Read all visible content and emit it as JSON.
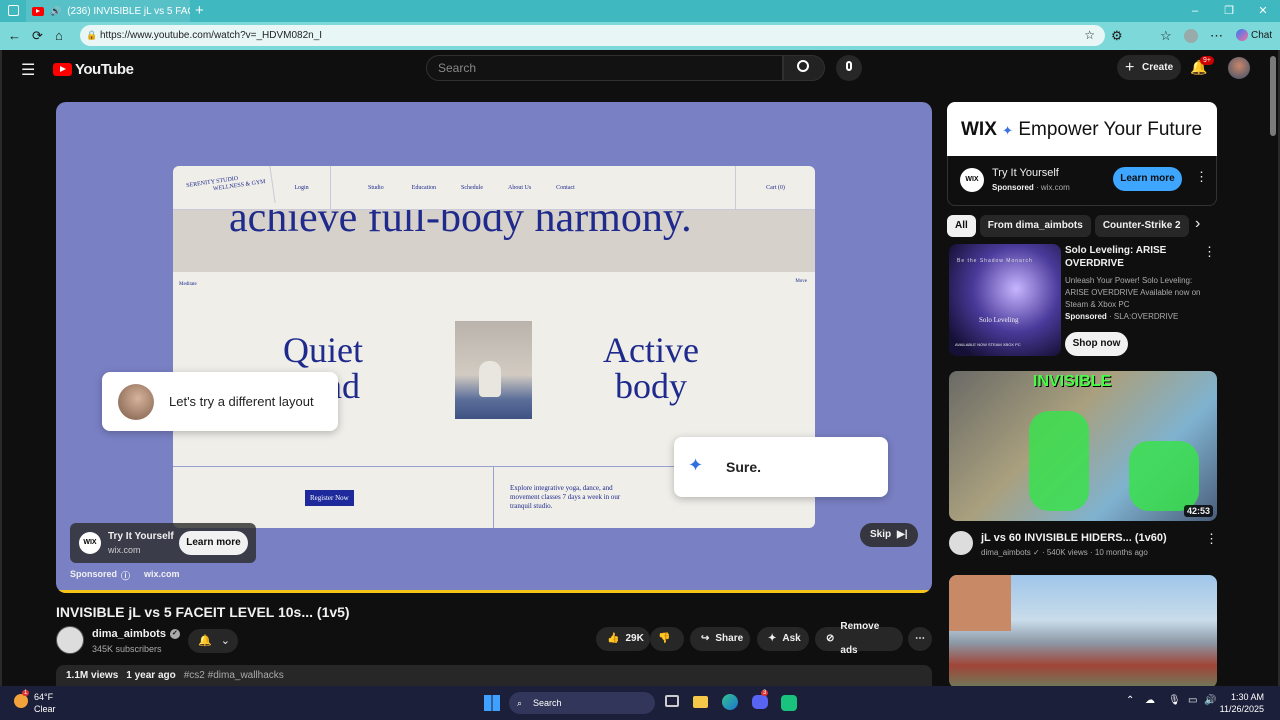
{
  "browser": {
    "tab_title": "(236) INVISIBLE jL vs 5 FACEI",
    "url": "https://www.youtube.com/watch?v=_HDVM082n_I",
    "chat_label": "Chat",
    "min": "–",
    "max": "❐",
    "close": "✕"
  },
  "header": {
    "logo_text": "YouTube",
    "search_placeholder": "Search",
    "create_label": "Create",
    "notif_badge": "9+"
  },
  "ad_site": {
    "logo_line1": "SERENITY STUDIO",
    "logo_line2": "WELLNESS & GYM",
    "nav": [
      "Login",
      "Studio",
      "Education",
      "Schedule",
      "About Us",
      "Contact"
    ],
    "cart": "Cart (0)",
    "hero_text": "achieve full-body harmony.",
    "meditate": "Meditate",
    "move": "Move",
    "quiet1": "Quiet",
    "quiet2": "mind",
    "active1": "Active",
    "active2": "body",
    "register": "Register Now",
    "desc": "Explore integrative yoga, dance, and movement classes 7 days a week in our tranquil studio."
  },
  "ad_bubbles": {
    "user_msg": "Let's try a different layout",
    "ai_reply": "Sure."
  },
  "ad_overlay": {
    "advertiser_logo": "WIX",
    "title": "Try It Yourself",
    "domain": "wix.com",
    "learn_more": "Learn more",
    "sponsored": "Sponsored",
    "info": "ⓘ",
    "sponsor_domain": "wix.com",
    "skip": "Skip"
  },
  "video": {
    "title": "INVISIBLE jL vs 5 FACEIT LEVEL 10s... (1v5)",
    "channel": "dima_aimbots",
    "subscribers": "345K subscribers",
    "likes": "29K",
    "share": "Share",
    "ask": "Ask",
    "remove_ads": "Remove ads",
    "views": "1.1M views",
    "age": "1 year ago",
    "tags": "#cs2 #dima_wallhacks"
  },
  "sidebar": {
    "banner_brand": "WIX",
    "banner_tagline": "Empower Your Future",
    "ad_title": "Try It Yourself",
    "ad_sponsored": "Sponsored",
    "ad_domain": "wix.com",
    "ad_learn_more": "Learn more",
    "chips": [
      "All",
      "From dima_aimbots",
      "Counter-Strike 2"
    ],
    "sponsored_game": {
      "title": "Solo Leveling: ARISE OVERDRIVE",
      "desc": "Unleash Your Power! Solo Leveling: ARISE OVERDRIVE Available now on Steam & Xbox PC",
      "sponsored": "Sponsored",
      "advertiser": "SLA:OVERDRIVE",
      "cta": "Shop now",
      "thumb_caption": "Be the Shadow Monarch",
      "thumb_logo": "Solo Leveling",
      "platforms": "AVAILABLE NOW  STEAM  XBOX PC"
    },
    "rec1": {
      "title": "jL vs 60 INVISIBLE HIDERS... (1v60)",
      "channel": "dima_aimbots",
      "views": "540K views",
      "age": "10 months ago",
      "duration": "42:53",
      "thumb_text": "INVISIBLE"
    }
  },
  "taskbar": {
    "temp": "64°F",
    "weather": "Clear",
    "search": "Search",
    "time": "1:30 AM",
    "date": "11/26/2025",
    "weather_badge": "1",
    "discord_badge": "3"
  }
}
